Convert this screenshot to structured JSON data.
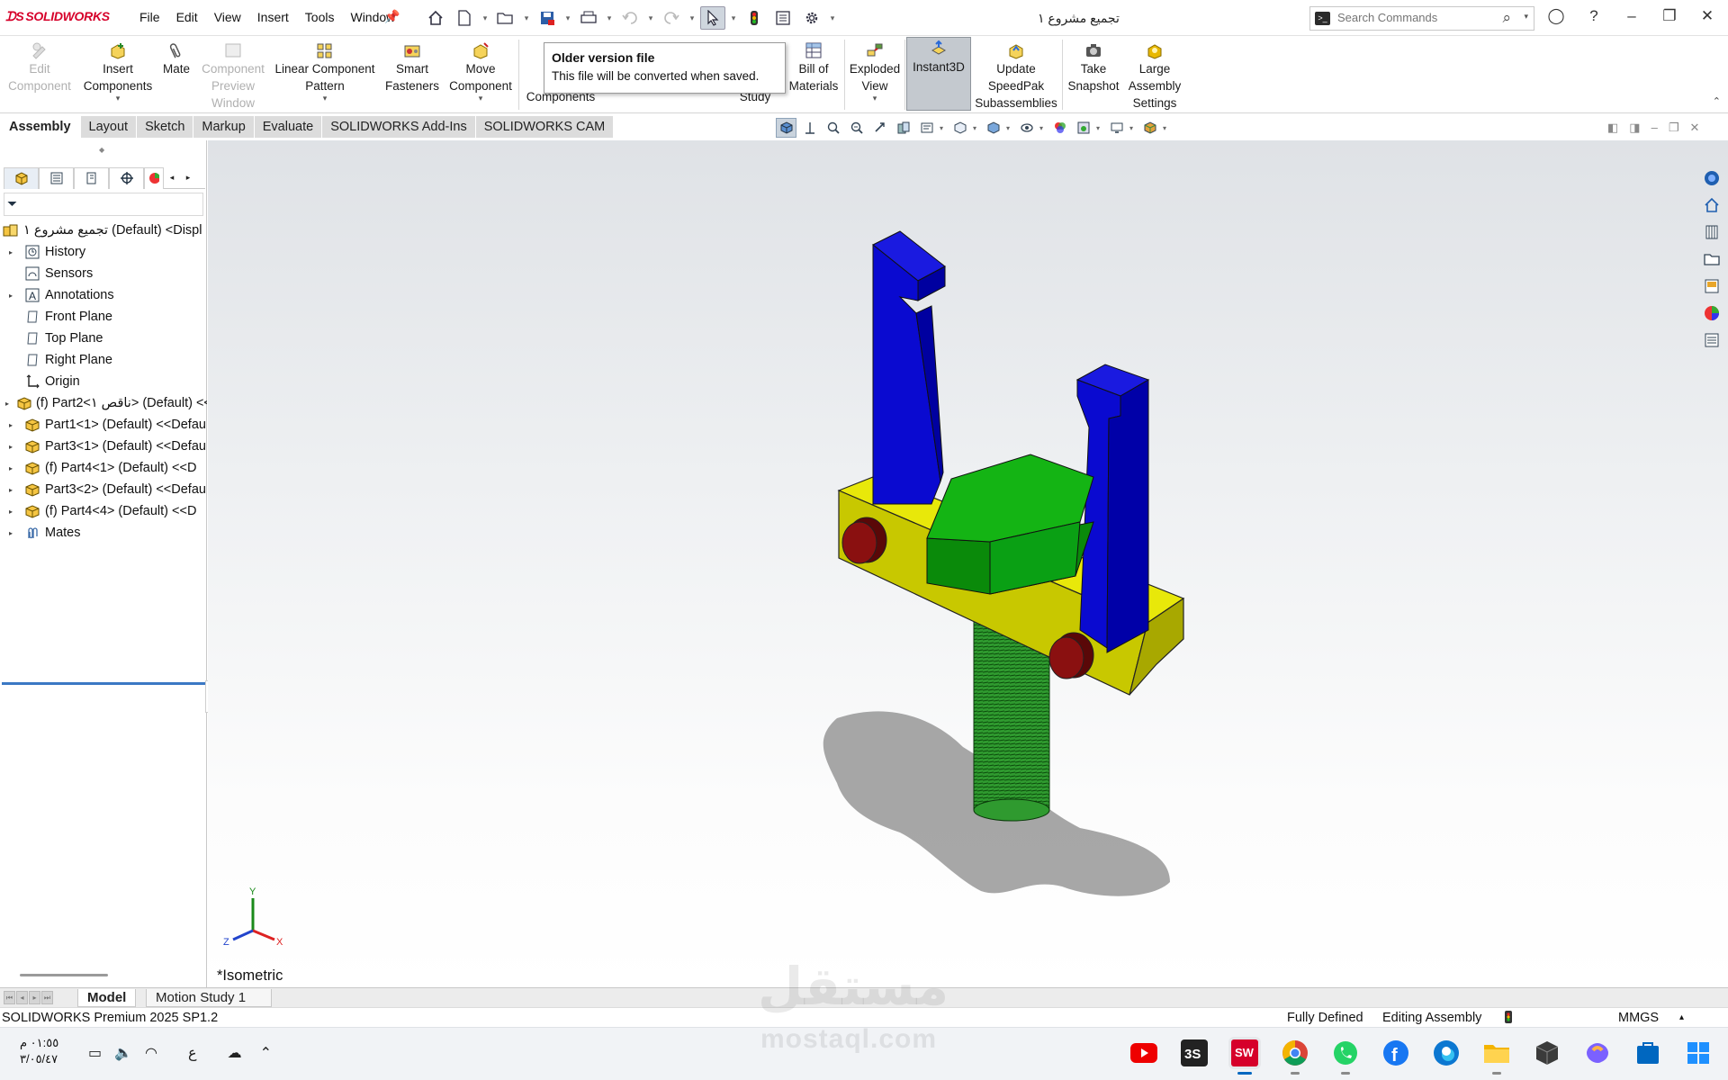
{
  "app": {
    "logo": "SOLIDWORKS",
    "document_title": "تجميع مشروع ١"
  },
  "menu": [
    "File",
    "Edit",
    "View",
    "Insert",
    "Tools",
    "Window"
  ],
  "search": {
    "placeholder": "Search Commands"
  },
  "ribbon": {
    "edit_component": "Edit Component",
    "insert_components": "Insert Components",
    "mate": "Mate",
    "component_preview": "Component Preview Window",
    "linear_pattern": "Linear Component Pattern",
    "smart_fasteners": "Smart Fasteners",
    "move_component": "Move Component",
    "show_hidden_partial": "Components",
    "study_partial": "Study",
    "bill_of_materials": "Bill of Materials",
    "exploded_view": "Exploded View",
    "instant3d": "Instant3D",
    "update_speedpak": "Update SpeedPak Subassemblies",
    "take_snapshot": "Take Snapshot",
    "large_assembly": "Large Assembly Settings"
  },
  "tooltip": {
    "title": "Older version file",
    "text": "This file will be converted when saved."
  },
  "cm_tabs": [
    "Assembly",
    "Layout",
    "Sketch",
    "Markup",
    "Evaluate",
    "SOLIDWORKS Add-Ins",
    "SOLIDWORKS CAM"
  ],
  "tree": {
    "root": "تجميع مشروع ١ (Default) <Displ",
    "items": [
      "History",
      "Sensors",
      "Annotations",
      "Front Plane",
      "Top Plane",
      "Right Plane",
      "Origin",
      "(f) Part2<ناقص ١> (Default) <<",
      "Part1<1> (Default) <<Defau",
      "Part3<1> (Default) <<Defau",
      "(f) Part4<1> (Default) <<D",
      "Part3<2> (Default) <<Defau",
      "(f) Part4<4> (Default) <<D",
      "Mates"
    ]
  },
  "view": {
    "orientation": "*Isometric"
  },
  "triad": {
    "x": "X",
    "y": "Y",
    "z": "Z"
  },
  "bottom_tabs": [
    "Model",
    "Motion Study 1"
  ],
  "status": {
    "product": "SOLIDWORKS Premium 2025 SP1.2",
    "state": "Fully Defined",
    "mode": "Editing Assembly",
    "units": "MMGS"
  },
  "taskbar": {
    "time": "٠١:٥٥ م",
    "date": "٣/٠٥/٤٧",
    "input_lang": "ع"
  },
  "watermark": {
    "arabic": "مستقل",
    "latin": "mostaql.com"
  },
  "colors": {
    "blue_part": "#0a0ad0",
    "green_part": "#0aa014",
    "yellow_part": "#d8d800",
    "red_part": "#8a0a0a",
    "screw": "#2b8a2b",
    "accent": "#0067c0"
  }
}
